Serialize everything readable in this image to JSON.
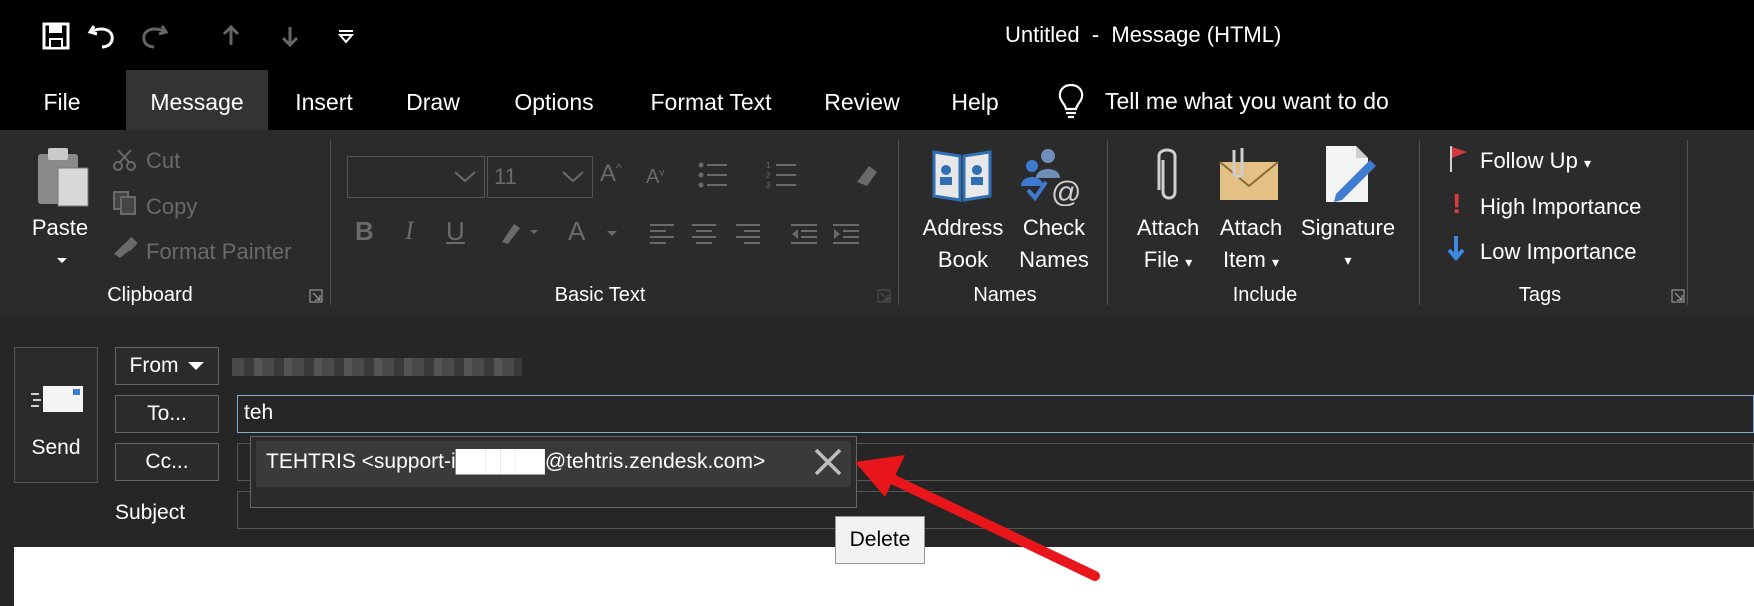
{
  "window": {
    "title": "Untitled  -  Message (HTML)"
  },
  "quick_access": [
    "save-icon",
    "undo-icon",
    "redo-icon",
    "up-arrow-icon",
    "down-arrow-icon",
    "customize-qat-icon"
  ],
  "tabs": [
    {
      "label": "File"
    },
    {
      "label": "Message",
      "active": true
    },
    {
      "label": "Insert"
    },
    {
      "label": "Draw"
    },
    {
      "label": "Options"
    },
    {
      "label": "Format Text"
    },
    {
      "label": "Review"
    },
    {
      "label": "Help"
    }
  ],
  "tell_me": "Tell me what you want to do",
  "ribbon": {
    "clipboard": {
      "paste": "Paste",
      "cut": "Cut",
      "copy": "Copy",
      "format_painter": "Format Painter",
      "label": "Clipboard"
    },
    "basic_text": {
      "font_size": "11",
      "bold": "B",
      "italic": "I",
      "underline": "U",
      "label": "Basic Text"
    },
    "names": {
      "address_book_1": "Address",
      "address_book_2": "Book",
      "check_names_1": "Check",
      "check_names_2": "Names",
      "label": "Names"
    },
    "include": {
      "attach_file_1": "Attach",
      "attach_file_2": "File",
      "attach_item_1": "Attach",
      "attach_item_2": "Item",
      "signature": "Signature",
      "label": "Include"
    },
    "tags": {
      "follow_up": "Follow Up",
      "high_importance": "High Importance",
      "low_importance": "Low Importance",
      "label": "Tags"
    }
  },
  "compose": {
    "send": "Send",
    "from": "From",
    "to": "To...",
    "cc": "Cc...",
    "subject": "Subject",
    "to_value": "teh",
    "suggestion": "TEHTRIS <support-i██████@tehtris.zendesk.com>",
    "tooltip": "Delete"
  },
  "colors": {
    "accent_focus": "#7fa9d6",
    "annotation_arrow": "#e8151b",
    "follow_up_flag": "#d9393d"
  }
}
